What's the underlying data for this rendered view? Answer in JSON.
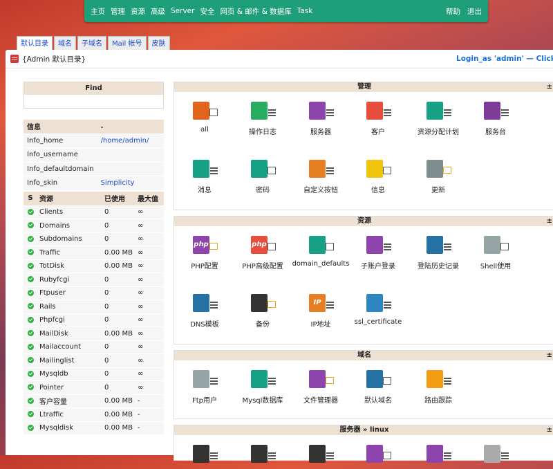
{
  "nav": {
    "left": [
      "主页",
      "管理",
      "资源",
      "高级",
      "Server",
      "安全",
      "网页 & 邮件 & 数据库",
      "Task"
    ],
    "right": [
      "帮助",
      "退出"
    ],
    "bg_color": "#1e9f7a"
  },
  "tabs": [
    "默认目录",
    "域名",
    "子域名",
    "Mail 帐号",
    "皮肤"
  ],
  "header": {
    "title": "{Admin 默认目录}",
    "login": "Login_as 'admin' — Click_he"
  },
  "find": {
    "label": "Find"
  },
  "info": {
    "header": [
      "信息",
      "."
    ],
    "rows": [
      {
        "key": "Info_home",
        "value": "/home/admin/"
      },
      {
        "key": "Info_username",
        "value": ""
      },
      {
        "key": "Info_defaultdomain",
        "value": ""
      },
      {
        "key": "Info_skin",
        "value": "Simplicity"
      }
    ]
  },
  "resources": {
    "header": [
      "S",
      "资源",
      "已使用",
      "最大值"
    ],
    "rows": [
      {
        "name": "Clients",
        "used": "0",
        "max": "∞"
      },
      {
        "name": "Domains",
        "used": "0",
        "max": "∞"
      },
      {
        "name": "Subdomains",
        "used": "0",
        "max": "∞"
      },
      {
        "name": "Traffic",
        "used": "0.00 MB",
        "max": "∞"
      },
      {
        "name": "TotDisk",
        "used": "0.00 MB",
        "max": "∞"
      },
      {
        "name": "Rubyfcgi",
        "used": "0",
        "max": "∞"
      },
      {
        "name": "Ftpuser",
        "used": "0",
        "max": "∞"
      },
      {
        "name": "Rails",
        "used": "0",
        "max": "∞"
      },
      {
        "name": "Phpfcgi",
        "used": "0",
        "max": "∞"
      },
      {
        "name": "MailDisk",
        "used": "0.00 MB",
        "max": "∞"
      },
      {
        "name": "Mailaccount",
        "used": "0",
        "max": "∞"
      },
      {
        "name": "Mailinglist",
        "used": "0",
        "max": "∞"
      },
      {
        "name": "Mysqldb",
        "used": "0",
        "max": "∞"
      },
      {
        "name": "Pointer",
        "used": "0",
        "max": "∞"
      },
      {
        "name": "客户容量",
        "used": "0.00 MB",
        "max": "-"
      },
      {
        "name": "Ltraffic",
        "used": "0.00 MB",
        "max": "-"
      },
      {
        "name": "Mysqldisk",
        "used": "0.00 MB",
        "max": "-"
      }
    ]
  },
  "sections": [
    {
      "title": "管理",
      "toggle": "±",
      "items": [
        {
          "label": "all",
          "icon": "users-icon",
          "color": "#e1641c",
          "badge": "edit"
        },
        {
          "label": "操作日志",
          "icon": "log-icon",
          "color": "#27ae60",
          "badge": "list"
        },
        {
          "label": "服务器",
          "icon": "server-icon",
          "color": "#8e44ad",
          "badge": "list"
        },
        {
          "label": "客户",
          "icon": "client-icon",
          "color": "#e74c3c",
          "badge": "list"
        },
        {
          "label": "资源分配计划",
          "icon": "plan-icon",
          "color": "#16a085",
          "badge": "list"
        },
        {
          "label": "服务台",
          "icon": "ticket-icon",
          "color": "#7d3c98",
          "badge": "list"
        },
        {
          "label": "消息",
          "icon": "message-icon",
          "color": "#16a085",
          "badge": "list"
        },
        {
          "label": "密码",
          "icon": "password-icon",
          "color": "#16a085",
          "badge": "edit"
        },
        {
          "label": "自定义按钮",
          "icon": "custom-button-icon",
          "color": "#e67e22",
          "badge": "list"
        },
        {
          "label": "信息",
          "icon": "info-icon",
          "color": "#f1c40f",
          "badge": "edit"
        },
        {
          "label": "更新",
          "icon": "update-icon",
          "color": "#7f8c8d",
          "badge": "mon"
        }
      ]
    },
    {
      "title": "资源",
      "toggle": "±",
      "items": [
        {
          "label": "PHP配置",
          "icon": "php-icon",
          "color": "#8e44ad",
          "badge": "mon",
          "glyph": "php"
        },
        {
          "label": "PHP高级配置",
          "icon": "php-advanced-icon",
          "color": "#e74c3c",
          "badge": "edit",
          "glyph": "php"
        },
        {
          "label": "domain_defaults",
          "icon": "domain-defaults-icon",
          "color": "#16a085",
          "badge": "edit"
        },
        {
          "label": "子账户登录",
          "icon": "subaccount-login-icon",
          "color": "#8e44ad",
          "badge": "list"
        },
        {
          "label": "登陆历史记录",
          "icon": "login-history-icon",
          "color": "#2471a3",
          "badge": "list"
        },
        {
          "label": "Shell使用",
          "icon": "shell-icon",
          "color": "#95a5a6",
          "badge": "edit"
        },
        {
          "label": "DNS模板",
          "icon": "dns-icon",
          "color": "#2471a3",
          "badge": "list"
        },
        {
          "label": "备份",
          "icon": "backup-icon",
          "color": "#333333",
          "badge": "mon"
        },
        {
          "label": "IP地址",
          "icon": "ip-icon",
          "color": "#e67e22",
          "badge": "list",
          "glyph": "IP"
        },
        {
          "label": "ssl_certificate",
          "icon": "ssl-icon",
          "color": "#2e86c1",
          "badge": "list"
        }
      ]
    },
    {
      "title": "域名",
      "toggle": "±",
      "items": [
        {
          "label": "Ftp用户",
          "icon": "ftp-user-icon",
          "color": "#95a5a6",
          "badge": "list"
        },
        {
          "label": "Mysql数据库",
          "icon": "mysql-icon",
          "color": "#16a085",
          "badge": "list"
        },
        {
          "label": "文件管理器",
          "icon": "file-manager-icon",
          "color": "#8e44ad",
          "badge": "mon"
        },
        {
          "label": "默认域名",
          "icon": "default-domain-icon",
          "color": "#2471a3",
          "badge": "edit"
        },
        {
          "label": "路由跟踪",
          "icon": "traceroute-icon",
          "color": "#f39c12",
          "badge": "list"
        }
      ]
    },
    {
      "title": "服务器 » linux",
      "toggle": "±",
      "items": [
        {
          "label": "",
          "icon": "server-icon",
          "color": "#333333",
          "badge": "list"
        },
        {
          "label": "",
          "icon": "server-icon",
          "color": "#333333",
          "badge": "list"
        },
        {
          "label": "",
          "icon": "server-icon",
          "color": "#333333",
          "badge": "list"
        },
        {
          "label": "",
          "icon": "server-icon",
          "color": "#8e44ad",
          "badge": "edit"
        },
        {
          "label": "",
          "icon": "server-icon",
          "color": "#8e44ad",
          "badge": "list"
        },
        {
          "label": "",
          "icon": "server-icon",
          "color": "#aaaaaa",
          "badge": "list"
        }
      ]
    }
  ]
}
